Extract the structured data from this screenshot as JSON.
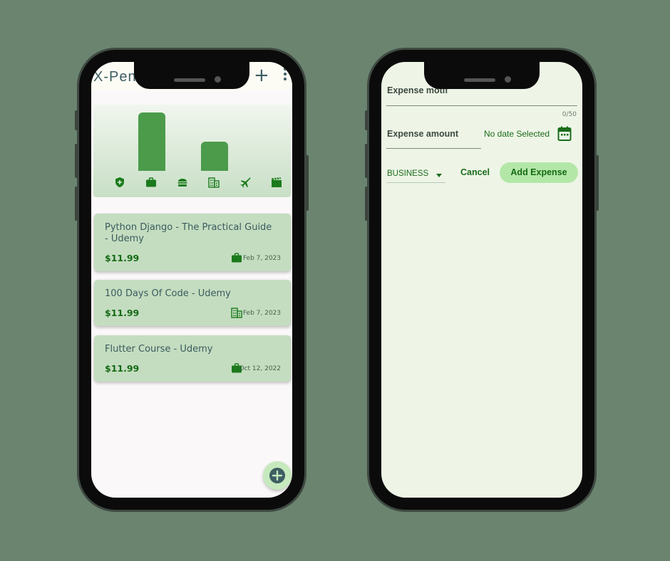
{
  "left_screen": {
    "app_title": "X-Pensia",
    "chart_data": {
      "type": "bar",
      "categories": [
        "insurance",
        "business",
        "food",
        "building",
        "travel",
        "movies"
      ],
      "values": [
        0,
        2,
        0,
        1,
        0,
        0
      ],
      "title": "",
      "xlabel": "",
      "ylabel": "",
      "ylim": [
        0,
        2
      ],
      "grid": false,
      "legend": "none",
      "bar_color": "#4b9b4b"
    },
    "expenses": [
      {
        "title": "Python Django - The Practical Guide - Udemy",
        "amount": "$11.99",
        "date": "Feb 7, 2023",
        "category_icon": "briefcase-icon"
      },
      {
        "title": "100 Days Of Code - Udemy",
        "amount": "$11.99",
        "date": "Feb 7, 2023",
        "category_icon": "building-icon"
      },
      {
        "title": "Flutter Course - Udemy",
        "amount": "$11.99",
        "date": "Oct 12, 2022",
        "category_icon": "briefcase-icon"
      }
    ],
    "fab_icon": "add-circle-icon"
  },
  "right_screen": {
    "motif_label": "Expense motif",
    "motif_value": "",
    "motif_counter": "0/50",
    "amount_label": "Expense amount",
    "amount_value": "",
    "date_status": "No date Selected",
    "category_value": "BUSINESS",
    "cancel_label": "Cancel",
    "add_label": "Add Expense",
    "accent_color": "#1b6d1b"
  }
}
